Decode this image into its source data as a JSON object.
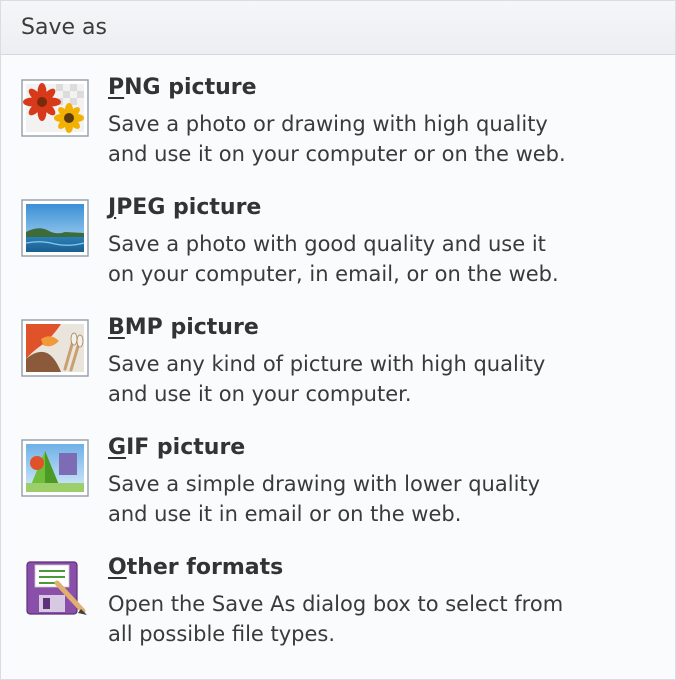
{
  "header": {
    "title": "Save as"
  },
  "items": [
    {
      "title_mnemonic": "P",
      "title_rest": "NG picture",
      "line1": "Save a photo or drawing with high quality",
      "line2": "and use it on your computer or on the web.",
      "icon": "png-picture-icon"
    },
    {
      "title_mnemonic": "J",
      "title_rest": "PEG picture",
      "line1": "Save a photo with good quality and use it",
      "line2": "on your computer, in email, or on the web.",
      "icon": "jpeg-picture-icon"
    },
    {
      "title_mnemonic": "B",
      "title_rest": "MP picture",
      "line1": "Save any kind of picture with high quality",
      "line2": "and use it on your computer.",
      "icon": "bmp-picture-icon"
    },
    {
      "title_mnemonic": "G",
      "title_rest": "IF picture",
      "line1": "Save a simple drawing with lower quality",
      "line2": "and use it in email or on the web.",
      "icon": "gif-picture-icon"
    },
    {
      "title_mnemonic": "O",
      "title_rest": "ther formats",
      "line1": "Open the Save As dialog box to select from",
      "line2": "all possible file types.",
      "icon": "other-formats-icon"
    }
  ]
}
